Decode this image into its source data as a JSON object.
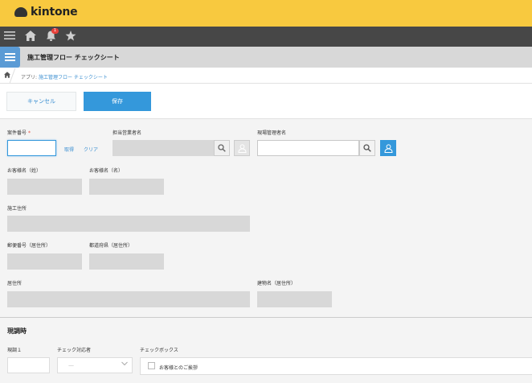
{
  "brand": {
    "name": "kintone",
    "color": "#f8c93f"
  },
  "nav": {
    "icons": [
      "menu-icon",
      "home-icon",
      "bell-icon",
      "star-icon"
    ],
    "notification_count": "1"
  },
  "app": {
    "title": "施工管理フロー チェックシート"
  },
  "breadcrumb": {
    "prefix": "アプリ: ",
    "link": "施工管理フロー チェックシート"
  },
  "actions": {
    "cancel": "キャンセル",
    "save": "保存"
  },
  "form": {
    "case_number": {
      "label": "案件番号",
      "required": "*",
      "value": "",
      "fetch": "取得",
      "clear": "クリア"
    },
    "sales_rep": {
      "label": "担当営業者名",
      "value": ""
    },
    "site_manager": {
      "label": "現場管理者名",
      "value": ""
    },
    "customer_last": {
      "label": "お客様名（姓）",
      "value": ""
    },
    "customer_first": {
      "label": "お客様名（名）",
      "value": ""
    },
    "site_address": {
      "label": "施工住所",
      "value": ""
    },
    "postal_code": {
      "label": "郵便番号（居住所）",
      "value": ""
    },
    "prefecture": {
      "label": "都道府県（居住所）",
      "value": ""
    },
    "residence": {
      "label": "居住所",
      "value": ""
    },
    "building": {
      "label": "建物名（居住所）",
      "value": ""
    }
  },
  "survey": {
    "title": "現調時",
    "field1": {
      "label": "現調１",
      "value": ""
    },
    "checker": {
      "label": "チェック対応者",
      "value": "—"
    },
    "checkbox": {
      "label": "チェックボックス",
      "option": "お客様とのご挨拶"
    }
  },
  "colors": {
    "accent": "#3498db",
    "readonly": "#d8d8d8"
  }
}
